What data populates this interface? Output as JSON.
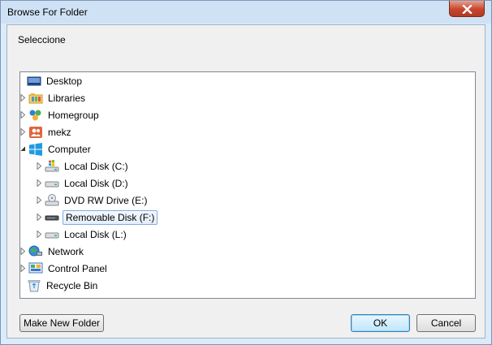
{
  "window": {
    "title": "Browse For Folder"
  },
  "prompt": "Seleccione",
  "tree": {
    "items": [
      {
        "label": "Desktop",
        "icon": "desktop-icon",
        "expander": "none"
      },
      {
        "label": "Libraries",
        "icon": "libraries-icon",
        "expander": "collapsed"
      },
      {
        "label": "Homegroup",
        "icon": "homegroup-icon",
        "expander": "collapsed"
      },
      {
        "label": "mekz",
        "icon": "user-folder-icon",
        "expander": "collapsed"
      },
      {
        "label": "Computer",
        "icon": "computer-icon",
        "expander": "expanded"
      },
      {
        "label": "Local Disk (C:)",
        "icon": "system-drive-icon",
        "expander": "collapsed"
      },
      {
        "label": "Local Disk (D:)",
        "icon": "hard-drive-icon",
        "expander": "collapsed"
      },
      {
        "label": "DVD RW Drive (E:)",
        "icon": "dvd-drive-icon",
        "expander": "collapsed"
      },
      {
        "label": "Removable Disk (F:)",
        "icon": "removable-drive-icon",
        "expander": "collapsed",
        "selected": true
      },
      {
        "label": "Local Disk (L:)",
        "icon": "hard-drive-icon",
        "expander": "collapsed"
      },
      {
        "label": "Network",
        "icon": "network-icon",
        "expander": "collapsed"
      },
      {
        "label": "Control Panel",
        "icon": "control-panel-icon",
        "expander": "collapsed"
      },
      {
        "label": "Recycle Bin",
        "icon": "recycle-bin-icon",
        "expander": "none"
      }
    ]
  },
  "buttons": {
    "make_new_folder": "Make New Folder",
    "ok": "OK",
    "cancel": "Cancel"
  },
  "colors": {
    "title_bar": "#cfe2f5",
    "close_button": "#c7452c",
    "selection_border": "#84acdd",
    "default_button_border": "#3c7fb1"
  }
}
